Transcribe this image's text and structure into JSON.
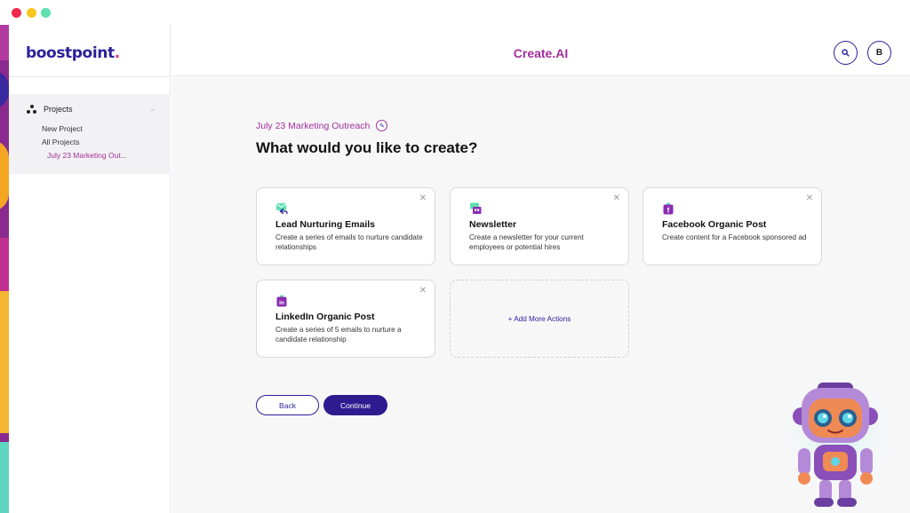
{
  "brand": {
    "logo_text": "boostpoint",
    "logo_dot": "."
  },
  "header": {
    "title": "Create.AI",
    "avatar_letter": "B"
  },
  "sidebar": {
    "section_label": "Projects",
    "items": [
      {
        "label": "New Project"
      },
      {
        "label": "All Projects"
      },
      {
        "label": "July 23 Marketing Out..."
      }
    ]
  },
  "main": {
    "subtitle": "July 23 Marketing Outreach",
    "headline": "What would you like to create?",
    "cards": [
      {
        "title": "Lead Nurturing Emails",
        "description": "Create a series of emails to nurture candidate relationships",
        "icon": "email-reply-icon"
      },
      {
        "title": "Newsletter",
        "description": "Create a newsletter for your current employees or potential hires",
        "icon": "newsletter-icon"
      },
      {
        "title": "Facebook Organic Post",
        "description": "Create content for a Facebook sponsored ad",
        "icon": "facebook-icon"
      },
      {
        "title": "LinkedIn Organic Post",
        "description": "Create a series of 5 emails to nurture a candidate relationship",
        "icon": "linkedin-icon"
      }
    ],
    "add_more_label": "+ Add More Actions",
    "back_label": "Back",
    "continue_label": "Continue"
  },
  "colors": {
    "brand_navy": "#2a1f9a",
    "brand_magenta": "#a22f9a",
    "accent_green": "#5ee0b0"
  }
}
